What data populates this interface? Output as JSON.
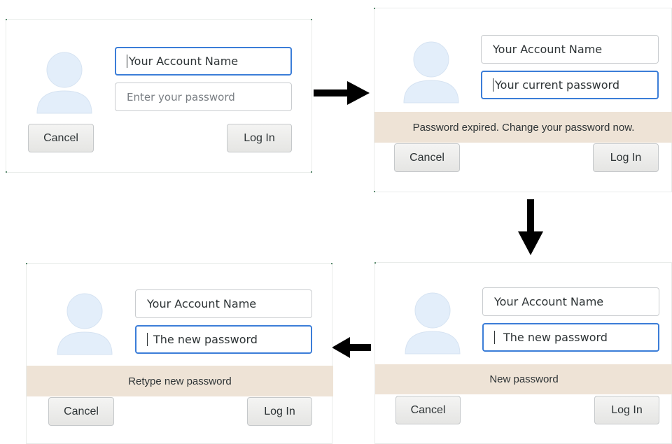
{
  "panels": [
    {
      "account_field": "Your Account Name",
      "password_placeholder": "Enter your password",
      "cancel_label": "Cancel",
      "login_label": "Log In"
    },
    {
      "account_field": "Your Account Name",
      "password_field": "Your current password",
      "banner": "Password expired. Change your password now.",
      "cancel_label": "Cancel",
      "login_label": "Log In"
    },
    {
      "account_field": "Your Account Name",
      "password_field": "The new password",
      "banner": "New password",
      "cancel_label": "Cancel",
      "login_label": "Log In"
    },
    {
      "account_field": "Your Account Name",
      "password_field": "The new password",
      "banner": "Retype new password",
      "cancel_label": "Cancel",
      "login_label": "Log In"
    }
  ],
  "colors": {
    "focus_border": "#3b7dd8",
    "banner_bg": "#eee3d6",
    "avatar": "#e3eefa"
  },
  "icons": [
    "avatar-icon",
    "arrow-right-icon",
    "arrow-down-icon",
    "arrow-left-icon"
  ]
}
